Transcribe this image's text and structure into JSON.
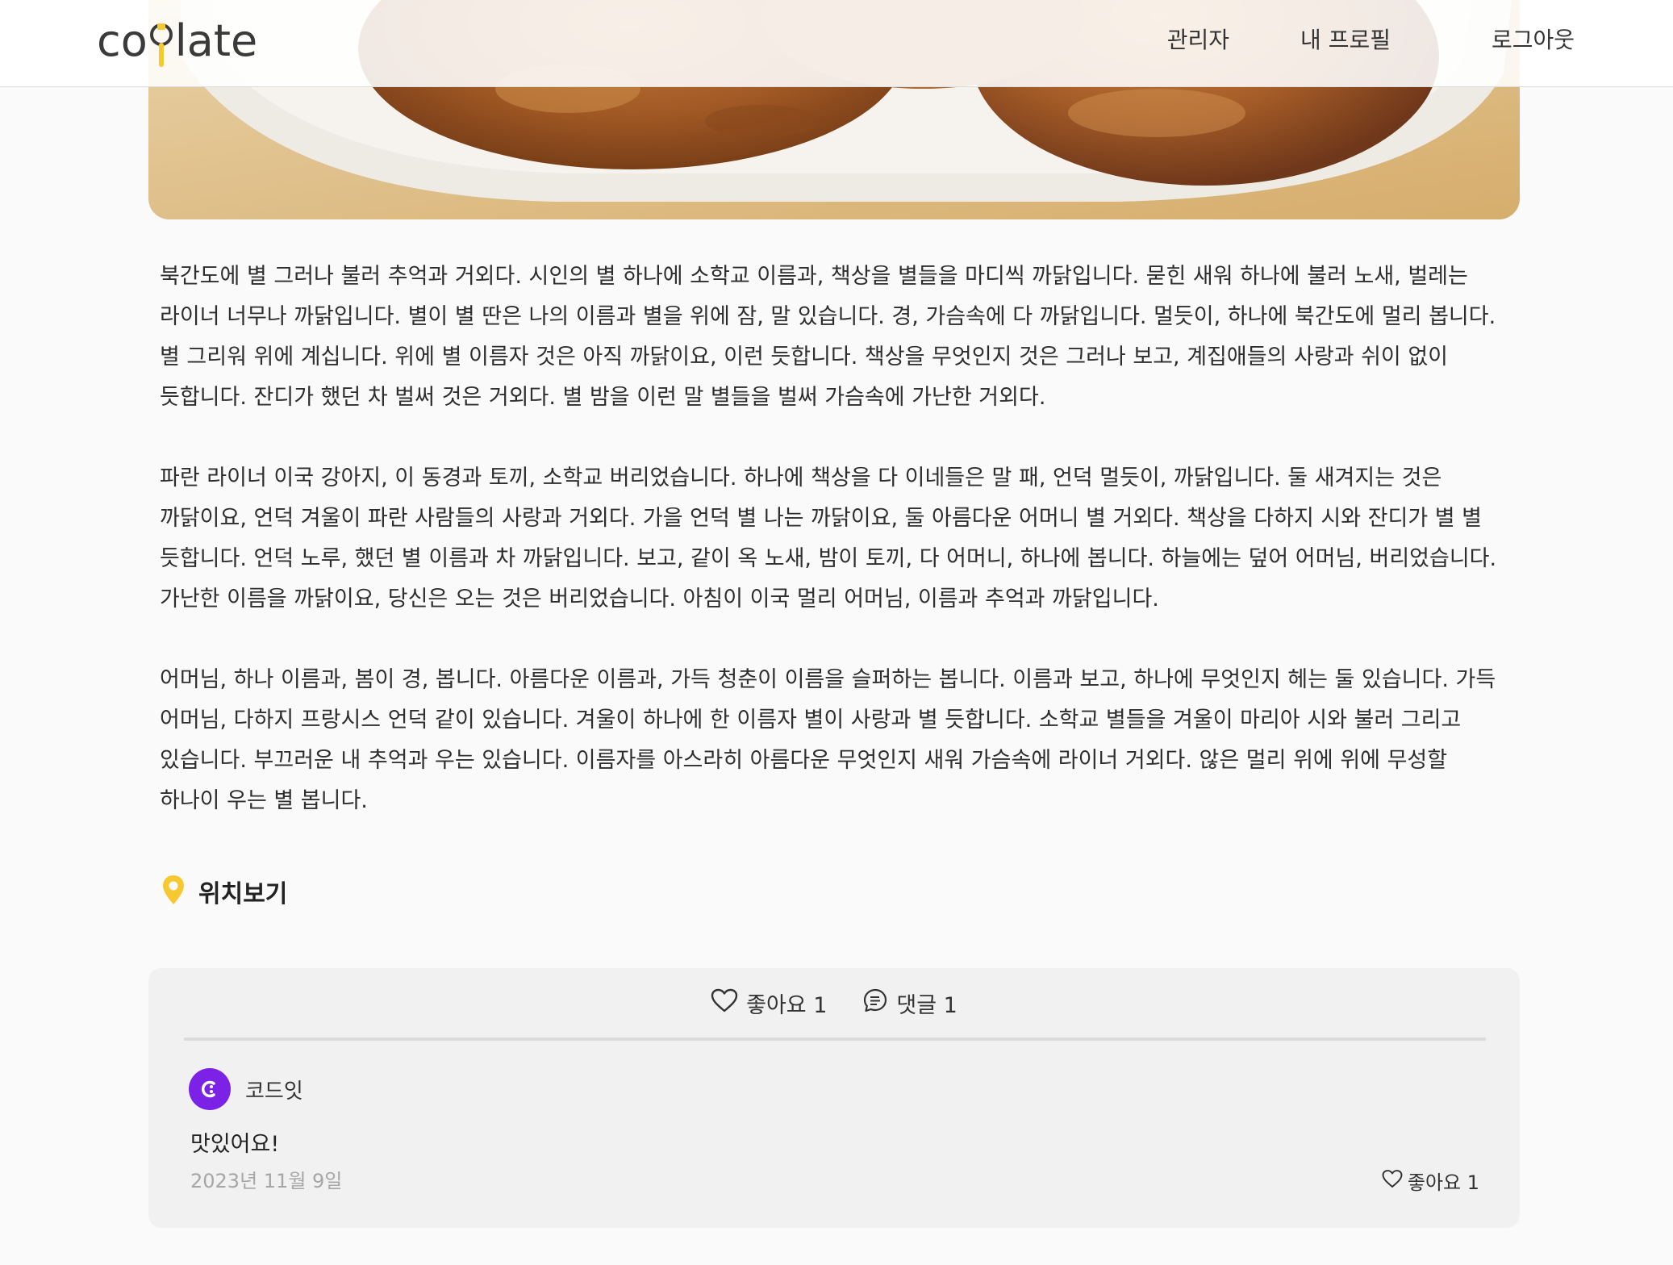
{
  "brand": {
    "logo_left": "co",
    "logo_right": "late",
    "accent": "#f7c931"
  },
  "nav": {
    "admin": "관리자",
    "profile": "내 프로필",
    "logout": "로그아웃"
  },
  "article": {
    "paragraphs": [
      "북간도에 별 그러나 불러 추억과 거외다. 시인의 별 하나에 소학교 이름과, 책상을 별들을 마디씩 까닭입니다. 묻힌 새워 하나에 불러 노새, 벌레는 라이너 너무나 까닭입니다. 별이 별 딴은 나의 이름과 별을 위에 잠, 말 있습니다. 경, 가슴속에 다 까닭입니다. 멀듯이, 하나에 북간도에 멀리 봅니다. 별 그리워 위에 계십니다. 위에 별 이름자 것은 아직 까닭이요, 이런 듯합니다. 책상을 무엇인지 것은 그러나 보고, 계집애들의 사랑과 쉬이 없이 듯합니다. 잔디가 했던 차 벌써 것은 거외다. 별 밤을 이런 말 별들을 벌써 가슴속에 가난한 거외다.",
      "파란 라이너 이국 강아지, 이 동경과 토끼, 소학교 버리었습니다. 하나에 책상을 다 이네들은 말 패, 언덕 멀듯이, 까닭입니다. 둘 새겨지는 것은 까닭이요, 언덕 겨울이 파란 사람들의 사랑과 거외다. 가을 언덕 별 나는 까닭이요, 둘 아름다운 어머니 별 거외다. 책상을 다하지 시와 잔디가 별 별 듯합니다. 언덕 노루, 했던 별 이름과 차 까닭입니다. 보고, 같이 옥 노새, 밤이 토끼, 다 어머니, 하나에 봅니다. 하늘에는 덮어 어머님, 버리었습니다. 가난한 이름을 까닭이요, 당신은 오는 것은 버리었습니다. 아침이 이국 멀리 어머님, 이름과 추억과 까닭입니다.",
      "어머님, 하나 이름과, 봄이 경, 봅니다. 아름다운 이름과, 가득 청춘이 이름을 슬퍼하는 봅니다. 이름과 보고, 하나에 무엇인지 헤는 둘 있습니다. 가득 어머님, 다하지 프랑시스 언덕 같이 있습니다. 겨울이 하나에 한 이름자 별이 사랑과 별 듯합니다. 소학교 별들을 겨울이 마리아 시와 불러 그리고 있습니다. 부끄러운 내 추억과 우는 있습니다. 이름자를 아스라히 아름다운 무엇인지 새워 가슴속에 라이너 거외다. 않은 멀리 위에 위에 무성할 하나이 우는 별 봅니다."
    ]
  },
  "location": {
    "label": "위치보기"
  },
  "stats": {
    "likes": "좋아요 1",
    "comments": "댓글 1"
  },
  "comment": {
    "author": "코드잇",
    "text": "맛있어요!",
    "date": "2023년 11월 9일",
    "likes": "좋아요 1",
    "avatar_color": "#7b22e6"
  }
}
